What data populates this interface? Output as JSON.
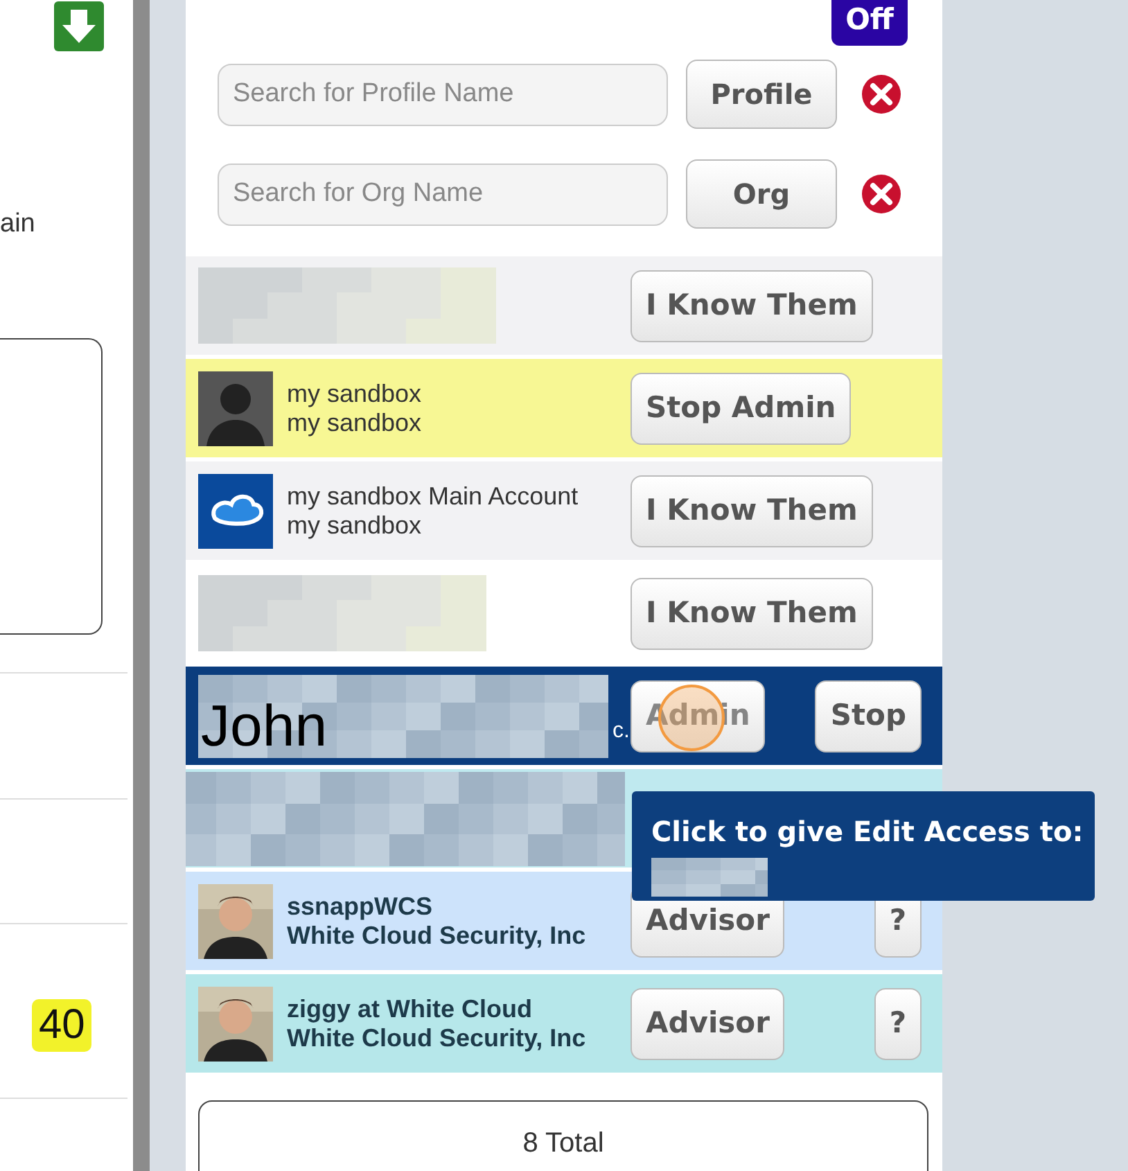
{
  "sidebar": {
    "label": "ain",
    "badge": "40"
  },
  "toggle": {
    "label": "Off"
  },
  "searches": [
    {
      "placeholder": "Search for Profile Name",
      "button": "Profile"
    },
    {
      "placeholder": "Search for Org Name",
      "button": "Org"
    }
  ],
  "rows": [
    {
      "kind": "redacted",
      "color": "#f2f2f4",
      "buttons": [
        {
          "label": "I Know Them"
        }
      ]
    },
    {
      "kind": "profile",
      "avatar": {
        "kind": "silhouette"
      },
      "color": "#f7f794",
      "name": "my sandbox",
      "org": "my sandbox",
      "bold": false,
      "buttons": [
        {
          "label": "Stop Admin"
        }
      ]
    },
    {
      "kind": "profile",
      "avatar": {
        "kind": "logo"
      },
      "color": "#f2f2f4",
      "name": "my sandbox Main Account",
      "org": "my sandbox",
      "bold": false,
      "buttons": [
        {
          "label": "I Know Them"
        }
      ]
    },
    {
      "kind": "redacted",
      "color": "#ffffff",
      "buttons": [
        {
          "label": "I Know Them"
        }
      ]
    },
    {
      "kind": "redacted",
      "color": "#0b3d7e",
      "text": "John",
      "tail": "c.",
      "buttons": [
        {
          "label": "Admin",
          "disabled": true,
          "clicked": true
        },
        {
          "label": "Stop",
          "disabled": false
        }
      ]
    },
    {
      "kind": "redacted",
      "color": "#bfe9ef"
    },
    {
      "kind": "profile",
      "color": "#cde3fb",
      "name": "ssnappWCS",
      "org": "White Cloud Security, Inc",
      "bold": true,
      "buttons": [
        {
          "label": "Advisor"
        },
        {
          "label": "?"
        }
      ]
    },
    {
      "kind": "profile",
      "color": "#b6e7ea",
      "name": "ziggy at White Cloud",
      "org": "White Cloud Security, Inc",
      "bold": true,
      "buttons": [
        {
          "label": "Advisor"
        },
        {
          "label": "?"
        }
      ]
    }
  ],
  "tooltip": {
    "text": "Click to give Edit Access to:"
  },
  "total": "8 Total"
}
